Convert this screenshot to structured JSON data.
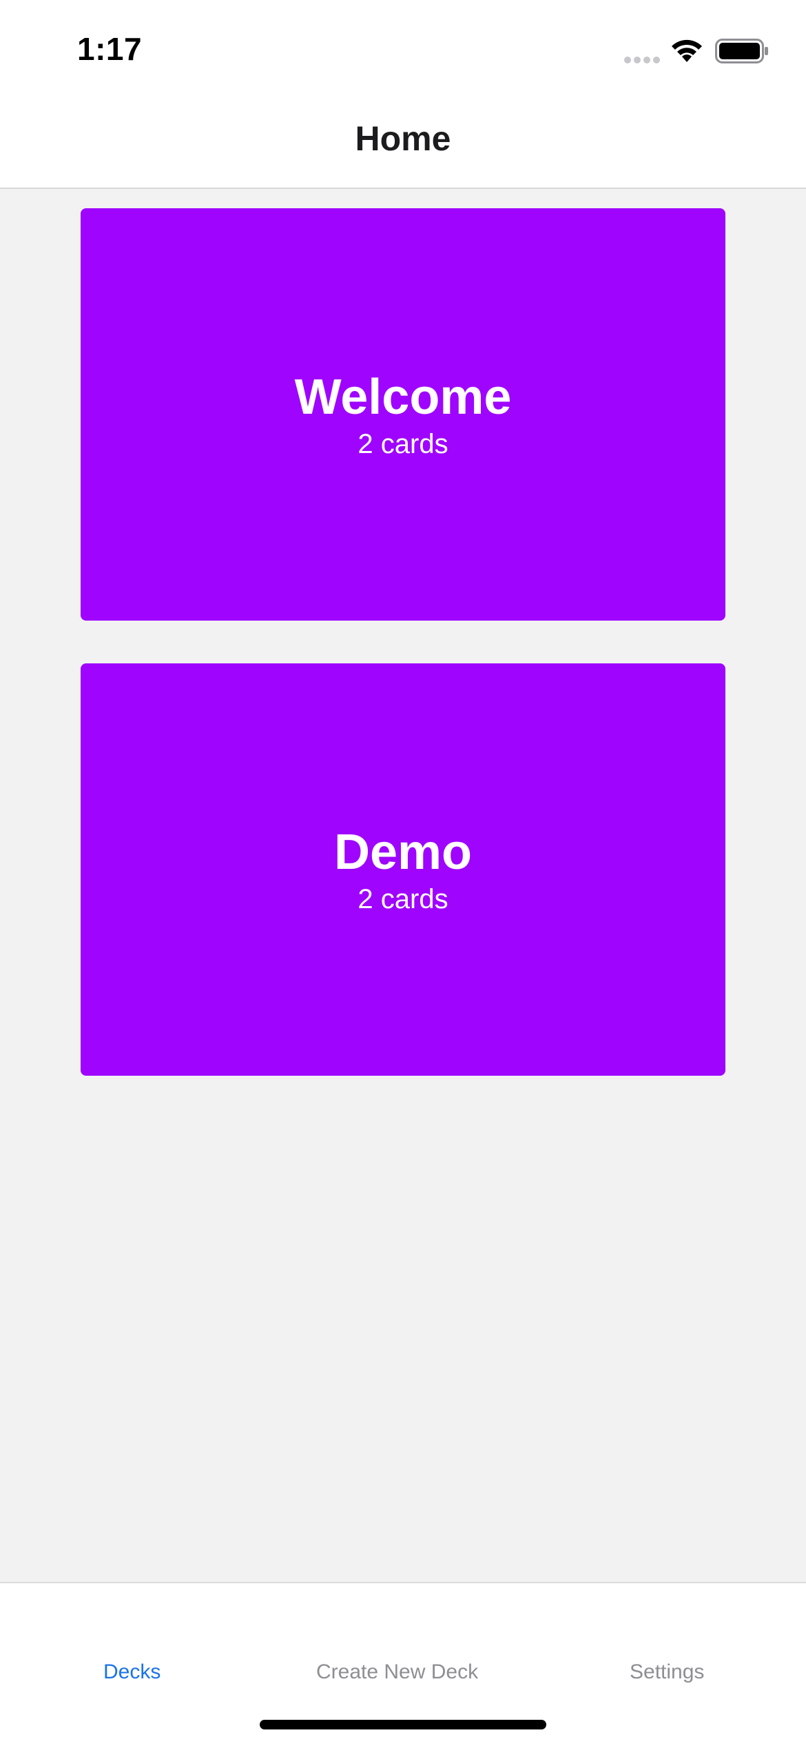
{
  "status_bar": {
    "time": "1:17",
    "icons": [
      "signal-icon",
      "wifi-icon",
      "battery-icon"
    ]
  },
  "header": {
    "title": "Home"
  },
  "colors": {
    "deck_background": "#9f04ff",
    "active_tab": "#1a73e8",
    "inactive_tab": "#8e8e93",
    "screen_background": "#f2f2f2"
  },
  "decks": [
    {
      "title": "Welcome",
      "count": "2 cards"
    },
    {
      "title": "Demo",
      "count": "2 cards"
    }
  ],
  "tabs": [
    {
      "label": "Decks",
      "active": true
    },
    {
      "label": "Create New Deck",
      "active": false
    },
    {
      "label": "Settings",
      "active": false
    }
  ]
}
